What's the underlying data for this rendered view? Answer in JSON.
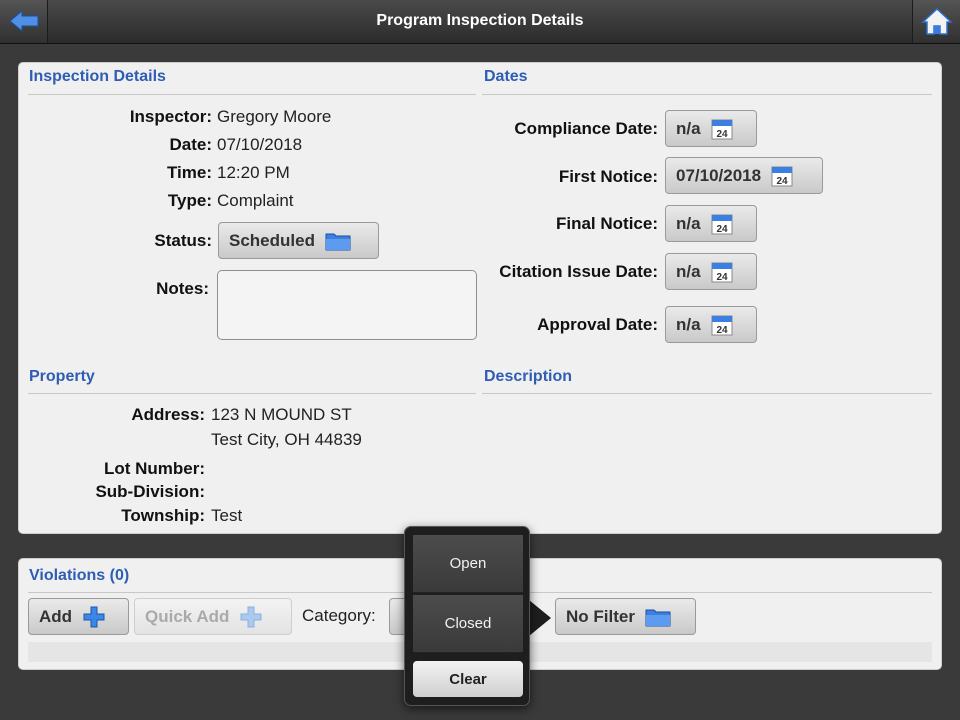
{
  "header": {
    "title": "Program Inspection Details",
    "back_icon": "back-arrow-icon",
    "home_icon": "home-icon"
  },
  "inspection": {
    "section_title": "Inspection Details",
    "inspector_label": "Inspector:",
    "inspector_value": "Gregory Moore",
    "date_label": "Date:",
    "date_value": "07/10/2018",
    "time_label": "Time:",
    "time_value": "12:20 PM",
    "type_label": "Type:",
    "type_value": "Complaint",
    "status_label": "Status:",
    "status_value": "Scheduled",
    "notes_label": "Notes:",
    "notes_value": ""
  },
  "dates": {
    "section_title": "Dates",
    "compliance_label": "Compliance Date:",
    "compliance_value": "n/a",
    "first_notice_label": "First Notice:",
    "first_notice_value": "07/10/2018",
    "final_notice_label": "Final Notice:",
    "final_notice_value": "n/a",
    "citation_label": "Citation Issue Date:",
    "citation_value": "n/a",
    "approval_label": "Approval Date:",
    "approval_value": "n/a",
    "calendar_day": "24"
  },
  "property": {
    "section_title": "Property",
    "address_label": "Address:",
    "address_line1": "123  N MOUND ST",
    "address_line2": "Test City, OH 44839",
    "lot_label": "Lot Number:",
    "lot_value": "",
    "subdivision_label": "Sub-Division:",
    "subdivision_value": "",
    "township_label": "Township:",
    "township_value": "Test"
  },
  "description": {
    "section_title": "Description"
  },
  "violations": {
    "section_title": "Violations (0)",
    "add_label": "Add",
    "quick_add_label": "Quick Add",
    "category_label": "Category:",
    "filter_value": "No Filter"
  },
  "popover": {
    "options": [
      "Open",
      "Closed"
    ],
    "clear_label": "Clear"
  },
  "colors": {
    "accent": "#2f5db3",
    "toolbar": "#2b2b2b",
    "panel": "#f0f0f0"
  }
}
